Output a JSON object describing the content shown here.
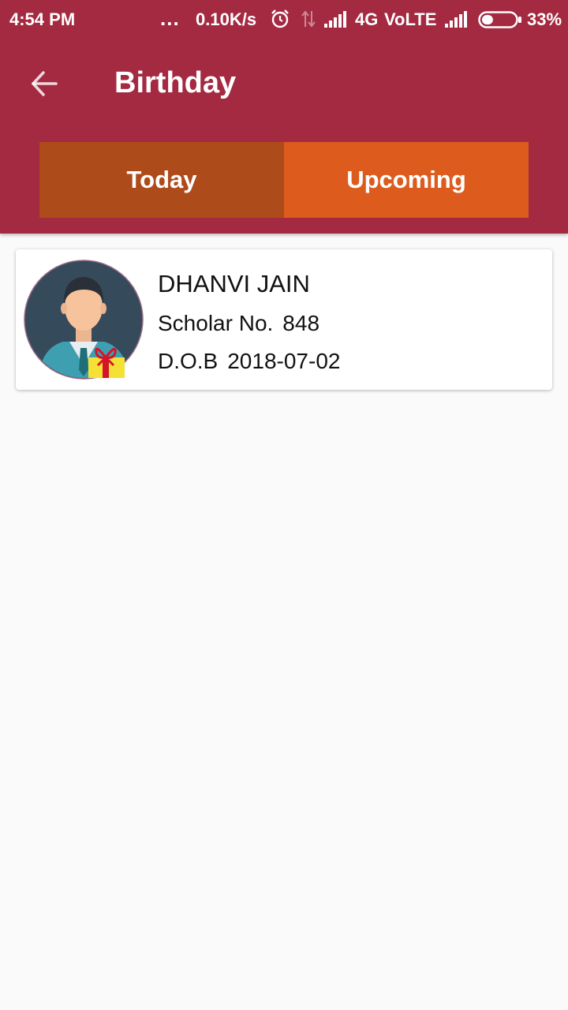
{
  "status_bar": {
    "time": "4:54 PM",
    "dots": "...",
    "speed": "0.10K/s",
    "network": "4G",
    "volte": "VoLTE",
    "battery": "33%",
    "battery_level": 0.33
  },
  "toolbar": {
    "title": "Birthday",
    "back_icon": "arrow-left-icon"
  },
  "tabs": [
    {
      "label": "Today",
      "active": true
    },
    {
      "label": "Upcoming",
      "active": false
    }
  ],
  "colors": {
    "header": "#a42a42",
    "tab_active": "#ae4b1b",
    "tab_inactive": "#dc5b1d",
    "background": "#fafafa"
  },
  "birthdays": [
    {
      "name": "DHANVI JAIN",
      "scholar_label": "Scholar No.",
      "scholar_no": "848",
      "dob_label": "D.O.B",
      "dob": "2018-07-02",
      "avatar_icon": "person-avatar-icon",
      "badge_icon": "gift-icon"
    }
  ]
}
